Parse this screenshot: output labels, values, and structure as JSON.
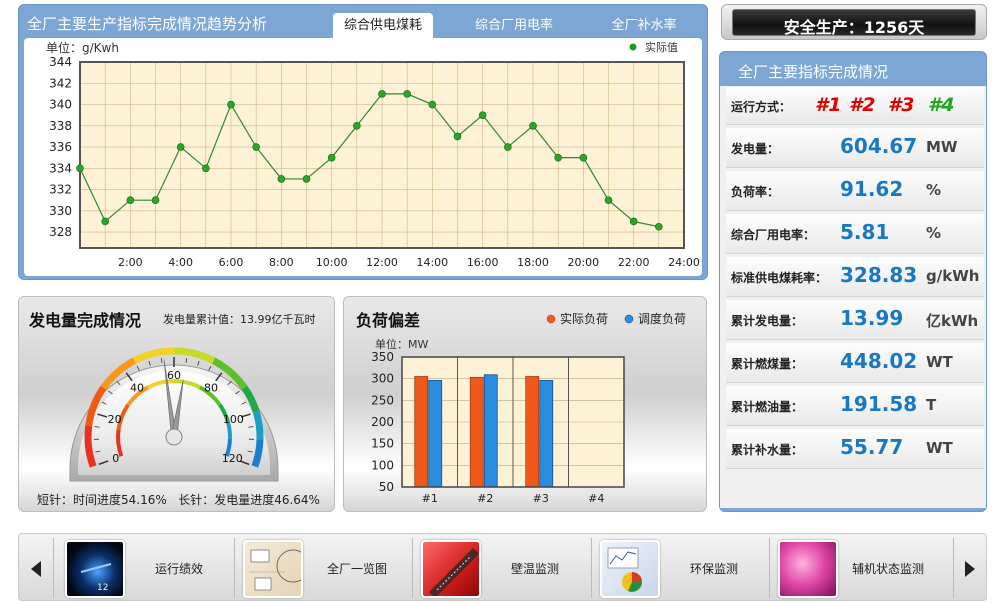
{
  "trend_panel": {
    "title": "全厂主要生产指标完成情况趋势分析",
    "tabs": [
      {
        "label": "综合供电煤耗",
        "active": true
      },
      {
        "label": "综合厂用电率",
        "active": false
      },
      {
        "label": "全厂补水率",
        "active": false
      }
    ],
    "unit": "单位：g/Kwh",
    "legend": "实际值"
  },
  "safety_banner": "安全生产：1256天",
  "indicators_panel": {
    "title": "全厂主要指标完成情况",
    "run_mode_label": "运行方式：",
    "units": [
      {
        "name": "#1",
        "color": "#e00000"
      },
      {
        "name": "#2",
        "color": "#e00000"
      },
      {
        "name": "#3",
        "color": "#e00000"
      },
      {
        "name": "#4",
        "color": "#1fa81f"
      }
    ],
    "rows": [
      {
        "label": "发电量：",
        "value": "604.67",
        "unit": "MW"
      },
      {
        "label": "负荷率：",
        "value": "91.62",
        "unit": "%"
      },
      {
        "label": "综合厂用电率：",
        "value": "5.81",
        "unit": "%"
      },
      {
        "label": "标准供电煤耗率：",
        "value": "328.83",
        "unit": "g/kWh"
      },
      {
        "label": "累计发电量：",
        "value": "13.99",
        "unit": "亿kWh"
      },
      {
        "label": "累计燃煤量：",
        "value": "448.02",
        "unit": "WT"
      },
      {
        "label": "累计燃油量：",
        "value": "191.58",
        "unit": "T"
      },
      {
        "label": "累计补水量：",
        "value": "55.77",
        "unit": "WT"
      }
    ]
  },
  "gen_panel": {
    "title": "发电量完成情况",
    "cumulative": "发电量累计值：13.99亿千瓦时",
    "footer": "短针：时间进度54.16%   长针：发电量进度46.64%",
    "gauge_ticks": [
      "0",
      "20",
      "40",
      "60",
      "80",
      "100",
      "120"
    ],
    "short_needle_pct": 54.16,
    "long_needle_pct": 46.64
  },
  "load_panel": {
    "title": "负荷偏差",
    "legend_actual": "实际负荷",
    "legend_dispatch": "调度负荷",
    "unit": "单位：MW"
  },
  "nav": {
    "prev_icon": "triangle-left-icon",
    "next_icon": "triangle-right-icon",
    "items": [
      {
        "label": "运行绩效",
        "icon": "speedometer-thumb"
      },
      {
        "label": "全厂一览图",
        "icon": "document-thumb"
      },
      {
        "label": "壁温监测",
        "icon": "thermometer-thumb"
      },
      {
        "label": "环保监测",
        "icon": "chart-thumb"
      },
      {
        "label": "辅机状态监测",
        "icon": "pink-abstract-thumb"
      }
    ]
  },
  "colors": {
    "panel_blue": "#7ca6d3",
    "plot_bg": "#fdf1d6",
    "line": "#2e8b2e",
    "bar_actual": "#ef5a1c",
    "bar_dispatch": "#2a8de0",
    "value_blue": "#1a78c2"
  },
  "chart_data": [
    {
      "type": "line",
      "title": "",
      "xlabel": "",
      "ylabel": "单位：g/Kwh",
      "x_ticks": [
        "2:00",
        "4:00",
        "6:00",
        "8:00",
        "10:00",
        "12:00",
        "14:00",
        "16:00",
        "18:00",
        "20:00",
        "22:00",
        "24:00"
      ],
      "xlim": [
        0,
        24
      ],
      "y_ticks": [
        328,
        330,
        332,
        334,
        336,
        338,
        340,
        342,
        344
      ],
      "ylim": [
        326.5,
        344
      ],
      "grid": true,
      "legend_position": "top-right",
      "series": [
        {
          "name": "实际值",
          "x": [
            0,
            1,
            2,
            3,
            4,
            5,
            6,
            7,
            8,
            9,
            10,
            11,
            12,
            13,
            14,
            15,
            16,
            17,
            18,
            19,
            20,
            21,
            22,
            23
          ],
          "values": [
            334,
            329,
            331,
            331,
            336,
            334,
            340,
            336,
            333,
            333,
            335,
            338,
            341,
            341,
            340,
            337,
            339,
            336,
            338,
            335,
            335,
            331,
            329,
            328.5
          ]
        }
      ]
    },
    {
      "type": "bar",
      "title": "负荷偏差",
      "xlabel": "",
      "ylabel": "单位：MW",
      "categories": [
        "#1",
        "#2",
        "#3",
        "#4"
      ],
      "y_ticks": [
        50,
        100,
        150,
        200,
        250,
        300,
        350
      ],
      "ylim": [
        50,
        350
      ],
      "legend_position": "top-right",
      "series": [
        {
          "name": "实际负荷",
          "values": [
            305,
            303,
            305,
            null
          ]
        },
        {
          "name": "调度负荷",
          "values": [
            296,
            309,
            296,
            null
          ]
        }
      ]
    }
  ]
}
